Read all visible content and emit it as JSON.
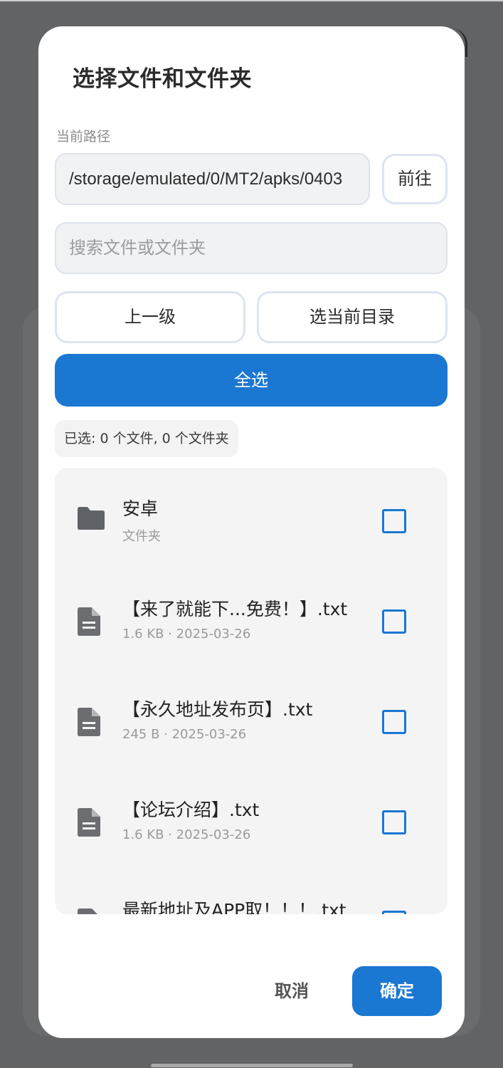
{
  "dialog": {
    "title": "选择文件和文件夹",
    "path_label": "当前路径",
    "path_value": "/storage/emulated/0/MT2/apks/0403",
    "go_label": "前往",
    "search_placeholder": "搜索文件或文件夹",
    "up_label": "上一级",
    "select_current_label": "选当前目录",
    "select_all_label": "全选",
    "summary": "已选: 0 个文件, 0 个文件夹",
    "cancel_label": "取消",
    "ok_label": "确定"
  },
  "items": [
    {
      "name": "安卓",
      "meta": "文件夹",
      "type": "folder-icon",
      "checked": false
    },
    {
      "name": "【来了就能下...免费！】.txt",
      "meta": "1.6 KB · 2025-03-26",
      "type": "file-icon",
      "checked": false
    },
    {
      "name": "【永久地址发布页】.txt",
      "meta": "245 B · 2025-03-26",
      "type": "file-icon",
      "checked": false
    },
    {
      "name": "【论坛介绍】.txt",
      "meta": "1.6 KB · 2025-03-26",
      "type": "file-icon",
      "checked": false
    },
    {
      "name": "最新地址及APP取！！！.txt",
      "meta": "",
      "type": "file-icon",
      "checked": false
    }
  ],
  "colors": {
    "accent": "#1a77d2",
    "scrim": "#626365"
  }
}
